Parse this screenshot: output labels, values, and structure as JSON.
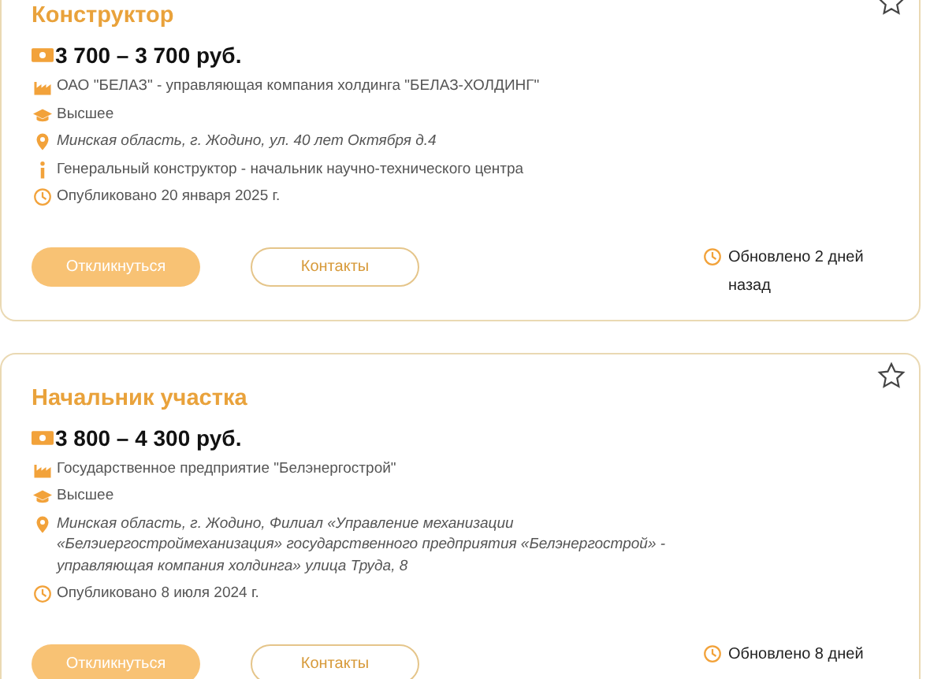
{
  "vacancies": [
    {
      "title": "Конструктор",
      "favorite": false,
      "salary": "3 700 – 3 700 руб.",
      "details": [
        {
          "kind": "company",
          "text": "ОАО \"БЕЛАЗ\" - управляющая компания холдинга \"БЕЛАЗ-ХОЛДИНГ\""
        },
        {
          "kind": "education",
          "text": "Высшее"
        },
        {
          "kind": "location",
          "text": "Минская область, г. Жодино, ул. 40 лет Октября д.4"
        },
        {
          "kind": "position",
          "text": "Генеральный конструктор - начальник научно-технического центра"
        },
        {
          "kind": "published",
          "text": "Опубликовано 20 января 2025 г."
        }
      ],
      "respond_button": "Откликнуться",
      "contacts_button": "Контакты",
      "updated": "Обновлено 2 дней назад"
    },
    {
      "title": "Начальник участка",
      "favorite": false,
      "salary": "3 800 – 4 300 руб.",
      "details": [
        {
          "kind": "company",
          "text": "Государственное предприятие \"Белэнергострой\""
        },
        {
          "kind": "education",
          "text": "Высшее"
        },
        {
          "kind": "location",
          "text": "Минская область, г. Жодино, Филиал «Управление механизации «Белэиергостроймеханизация» государственного предприятия «Белэнергострой» - управляющая компания холдинга» улица Труда, 8"
        },
        {
          "kind": "published",
          "text": "Опубликовано 8 июля 2024 г."
        }
      ],
      "respond_button": "Откликнуться",
      "contacts_button": "Контакты",
      "updated": "Обновлено 8 дней"
    }
  ]
}
